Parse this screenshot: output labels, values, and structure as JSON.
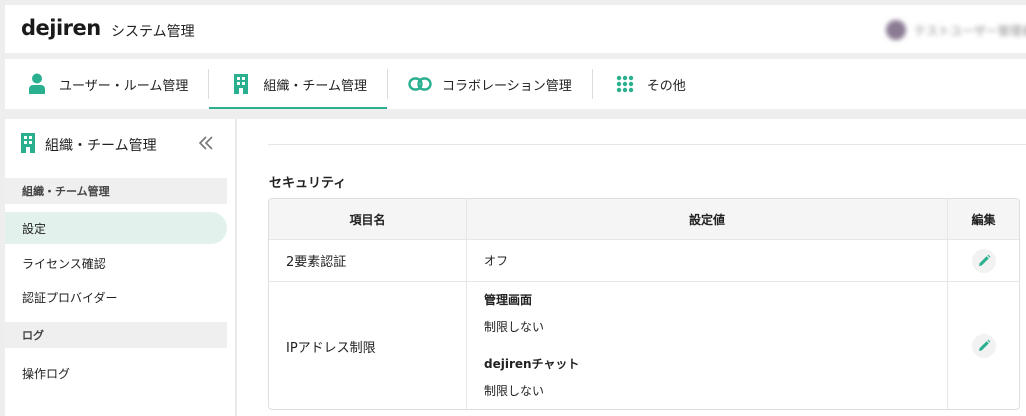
{
  "header": {
    "logo": "dejiren",
    "title": "システム管理",
    "user_name": "テストユーザー管理者"
  },
  "tabs": [
    {
      "label": "ユーザー・ルーム管理",
      "icon": "user-icon"
    },
    {
      "label": "組織・チーム管理",
      "icon": "building-icon",
      "active": true
    },
    {
      "label": "コラボレーション管理",
      "icon": "link-icon"
    },
    {
      "label": "その他",
      "icon": "grid-icon"
    }
  ],
  "sidebar": {
    "title": "組織・チーム管理",
    "sections": [
      {
        "label": "組織・チーム管理",
        "items": [
          "設定",
          "ライセンス確認",
          "認証プロバイダー"
        ]
      },
      {
        "label": "ログ",
        "items": [
          "操作ログ"
        ]
      }
    ],
    "active_item": "設定"
  },
  "main": {
    "section_title": "セキュリティ",
    "table": {
      "headers": [
        "項目名",
        "設定値",
        "編集"
      ],
      "rows": [
        {
          "name": "2要素認証",
          "value": "オフ"
        },
        {
          "name": "IPアドレス制限",
          "settings": [
            {
              "label": "管理画面",
              "value": "制限しない"
            },
            {
              "label": "dejirenチャット",
              "value": "制限しない"
            }
          ]
        }
      ]
    }
  },
  "colors": {
    "accent": "#2bb08f",
    "active_bg": "#e2f1ec",
    "background": "#eeeeee"
  }
}
